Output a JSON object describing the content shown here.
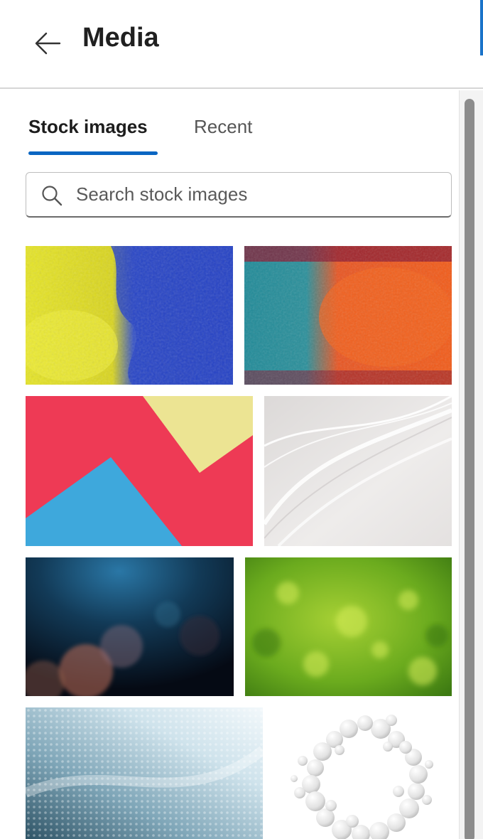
{
  "header": {
    "title": "Media",
    "back_icon": "arrow-left-icon"
  },
  "tabs": [
    {
      "label": "Stock images",
      "selected": true
    },
    {
      "label": "Recent",
      "selected": false
    }
  ],
  "search": {
    "placeholder": "Search stock images",
    "value": "",
    "icon": "search-icon"
  },
  "images": [
    {
      "name": "yellow-blue-powder",
      "colors": [
        "#e3e21c",
        "#2344c8"
      ]
    },
    {
      "name": "teal-orange-powder",
      "colors": [
        "#2a8f9a",
        "#f05a1c"
      ]
    },
    {
      "name": "red-yellow-blue-paper",
      "colors": [
        "#ee3a54",
        "#ece493",
        "#3fa8dc"
      ]
    },
    {
      "name": "white-waves",
      "colors": [
        "#e6e3e2",
        "#ffffff"
      ]
    },
    {
      "name": "dark-blue-bokeh",
      "colors": [
        "#0a2236",
        "#1e5e88"
      ]
    },
    {
      "name": "green-bokeh",
      "colors": [
        "#4f9a18",
        "#b6d838"
      ]
    },
    {
      "name": "light-blue-texture",
      "colors": [
        "#8fb6c9",
        "#e8f2f7"
      ]
    },
    {
      "name": "white-spheres-ring",
      "colors": [
        "#e9e9e9",
        "#ffffff"
      ]
    }
  ],
  "colors": {
    "accent": "#0a66c2",
    "scroll_accent": "#1a73c9"
  }
}
